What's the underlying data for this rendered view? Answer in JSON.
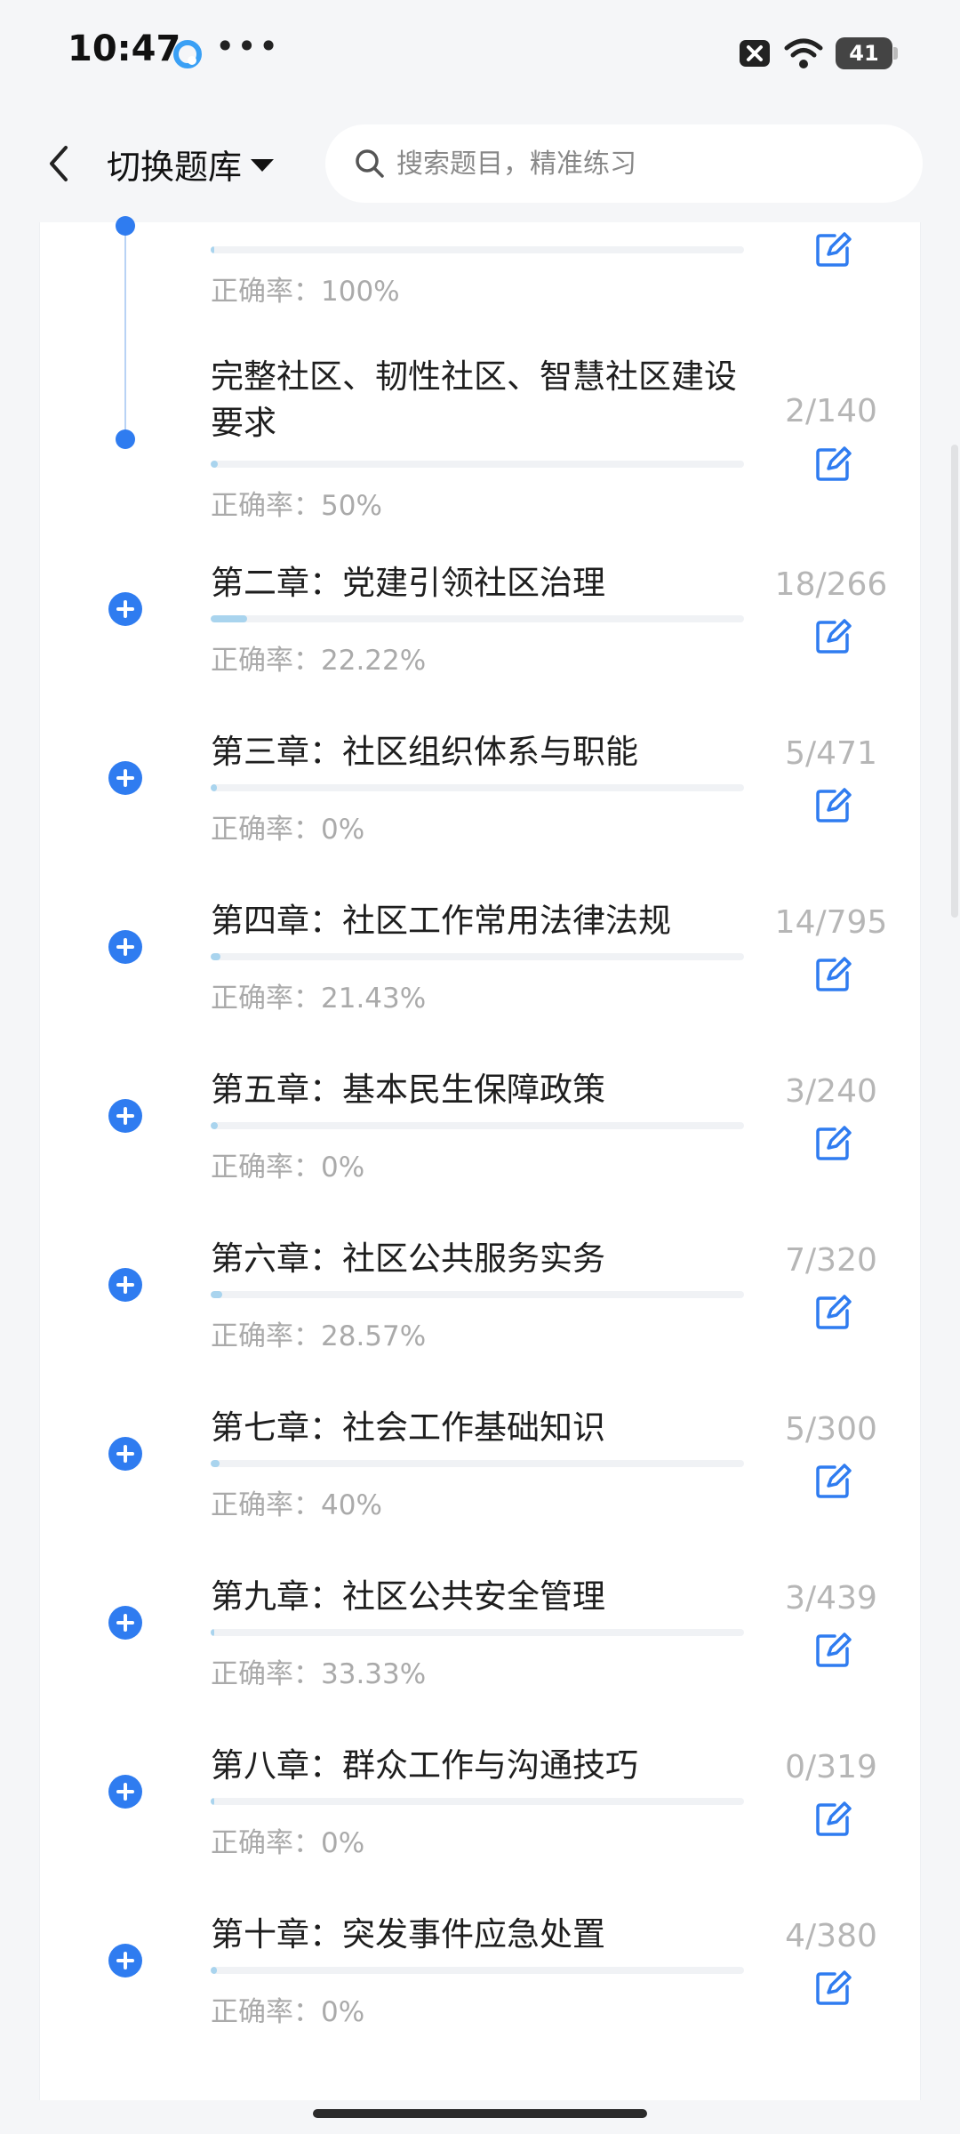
{
  "status_bar": {
    "time": "10:47",
    "dots": "•••",
    "battery": "41"
  },
  "header": {
    "switch_label": "切换题库",
    "search_placeholder": "搜索题目，精准练习"
  },
  "top_item": {
    "accuracy_label": "正确率：",
    "accuracy": "100%",
    "progress": 0.005
  },
  "items": [
    {
      "title": "完整社区、韧性社区、智慧社区建设要求",
      "accuracy_label": "正确率：",
      "accuracy": "50%",
      "count": "2/140",
      "progress": 0.014,
      "marker": "dot"
    },
    {
      "title": "第二章：党建引领社区治理",
      "accuracy_label": "正确率：",
      "accuracy": "22.22%",
      "count": "18/266",
      "progress": 0.068,
      "marker": "plus"
    },
    {
      "title": "第三章：社区组织体系与职能",
      "accuracy_label": "正确率：",
      "accuracy": "0%",
      "count": "5/471",
      "progress": 0.011,
      "marker": "plus"
    },
    {
      "title": "第四章：社区工作常用法律法规",
      "accuracy_label": "正确率：",
      "accuracy": "21.43%",
      "count": "14/795",
      "progress": 0.018,
      "marker": "plus"
    },
    {
      "title": "第五章：基本民生保障政策",
      "accuracy_label": "正确率：",
      "accuracy": "0%",
      "count": "3/240",
      "progress": 0.013,
      "marker": "plus"
    },
    {
      "title": "第六章：社区公共服务实务",
      "accuracy_label": "正确率：",
      "accuracy": "28.57%",
      "count": "7/320",
      "progress": 0.022,
      "marker": "plus"
    },
    {
      "title": "第七章：社会工作基础知识",
      "accuracy_label": "正确率：",
      "accuracy": "40%",
      "count": "5/300",
      "progress": 0.017,
      "marker": "plus"
    },
    {
      "title": "第九章：社区公共安全管理",
      "accuracy_label": "正确率：",
      "accuracy": "33.33%",
      "count": "3/439",
      "progress": 0.007,
      "marker": "plus"
    },
    {
      "title": "第八章：群众工作与沟通技巧",
      "accuracy_label": "正确率：",
      "accuracy": "0%",
      "count": "0/319",
      "progress": 0,
      "marker": "plus"
    },
    {
      "title": "第十章：突发事件应急处置",
      "accuracy_label": "正确率：",
      "accuracy": "0%",
      "count": "4/380",
      "progress": 0.011,
      "marker": "plus"
    }
  ],
  "colors": {
    "accent": "#2f7cf0",
    "progress_fill": "#a9d4ee",
    "muted": "#aaaaaa"
  },
  "icons": {
    "back": "chevron-left-icon",
    "search": "search-icon",
    "edit": "edit-icon",
    "expand": "plus-circle-icon"
  }
}
